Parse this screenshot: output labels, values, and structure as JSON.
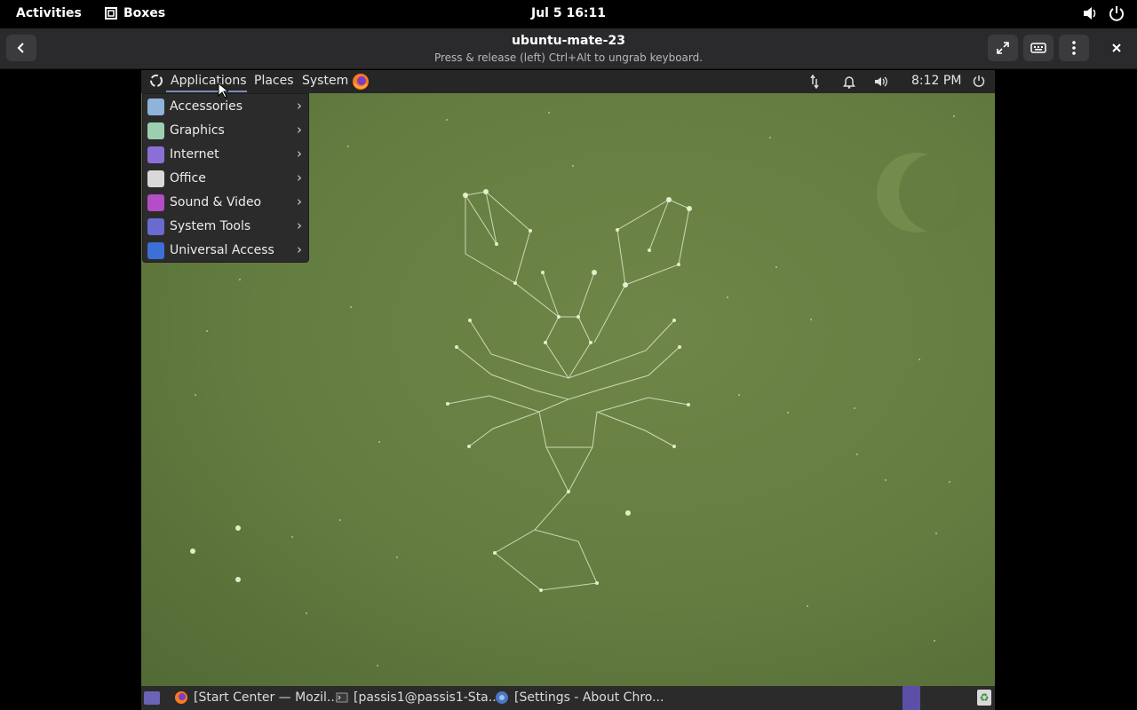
{
  "gnome_bar": {
    "activities": "Activities",
    "app_name": "Boxes",
    "datetime": "Jul 5  16:11"
  },
  "boxes_header": {
    "title": "ubuntu-mate-23",
    "subtitle": "Press & release (left) Ctrl+Alt to ungrab keyboard."
  },
  "mate_panel": {
    "applications": "Applications",
    "places": "Places",
    "system": "System",
    "time": "8:12 PM"
  },
  "apps_menu": {
    "items": [
      {
        "label": "Accessories",
        "icon": "accessories-icon",
        "color": "#8fb3d9"
      },
      {
        "label": "Graphics",
        "icon": "graphics-icon",
        "color": "#9ccfb0"
      },
      {
        "label": "Internet",
        "icon": "internet-icon",
        "color": "#8c6fd6"
      },
      {
        "label": "Office",
        "icon": "office-icon",
        "color": "#d9d9d9"
      },
      {
        "label": "Sound & Video",
        "icon": "sound-video-icon",
        "color": "#b54dc6"
      },
      {
        "label": "System Tools",
        "icon": "system-tools-icon",
        "color": "#6a6ad0"
      },
      {
        "label": "Universal Access",
        "icon": "universal-access-icon",
        "color": "#3d6fd6"
      }
    ]
  },
  "taskbar": {
    "tasks": [
      {
        "label": "[Start Center — Mozil...",
        "icon": "firefox-icon"
      },
      {
        "label": "[passis1@passis1-Sta...",
        "icon": "terminal-icon"
      },
      {
        "label": "[Settings - About Chro...",
        "icon": "chrome-icon"
      }
    ]
  },
  "colors": {
    "desktop": "#637c40",
    "panel": "#262626",
    "workspace_indicator": "#5b4fa6"
  }
}
